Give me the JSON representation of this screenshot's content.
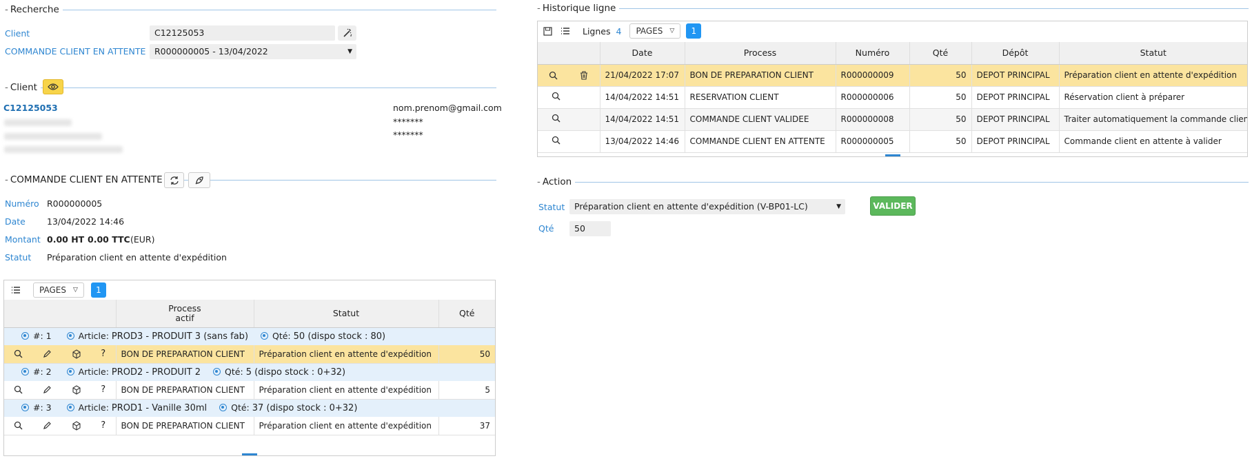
{
  "recherche": {
    "title": "Recherche",
    "client_label": "Client",
    "client_value": "C12125053",
    "commande_label": "COMMANDE CLIENT EN ATTENTE",
    "commande_value": "R000000005 - 13/04/2022"
  },
  "client": {
    "title": "Client",
    "code": "C12125053",
    "email": "nom.prenom@gmail.com",
    "masked1": "*******",
    "masked2": "*******"
  },
  "commande": {
    "title": "COMMANDE CLIENT EN ATTENTE",
    "numero_label": "Numéro",
    "numero": "R000000005",
    "date_label": "Date",
    "date": "13/04/2022 14:46",
    "montant_label": "Montant",
    "montant_ht": "0.00 HT",
    "montant_ttc": "0.00 TTC",
    "devise": "(EUR)",
    "statut_label": "Statut",
    "statut": "Préparation client en attente d'expédition"
  },
  "lines_table": {
    "pages_label": "PAGES",
    "page": "1",
    "headers": {
      "process_1": "Process",
      "process_2": "actif",
      "statut": "Statut",
      "qte": "Qté"
    },
    "groups": [
      {
        "num_label": "#:",
        "num": "1",
        "article_label": "Article:",
        "article": "PROD3 - PRODUIT 3 (sans fab)",
        "qte_label": "Qté:",
        "qte": "50 (dispo stock : 80)",
        "row": {
          "process": "BON DE PREPARATION CLIENT",
          "statut": "Préparation client en attente d'expédition",
          "qte": "50"
        }
      },
      {
        "num_label": "#:",
        "num": "2",
        "article_label": "Article:",
        "article": "PROD2 - PRODUIT 2",
        "qte_label": "Qté:",
        "qte": "5 (dispo stock : 0+32)",
        "row": {
          "process": "BON DE PREPARATION CLIENT",
          "statut": "Préparation client en attente d'expédition",
          "qte": "5"
        }
      },
      {
        "num_label": "#:",
        "num": "3",
        "article_label": "Article:",
        "article": "PROD1 - Vanille 30ml",
        "qte_label": "Qté:",
        "qte": "37 (dispo stock : 0+32)",
        "row": {
          "process": "BON DE PREPARATION CLIENT",
          "statut": "Préparation client en attente d'expédition",
          "qte": "37"
        }
      }
    ]
  },
  "historique": {
    "title": "Historique ligne",
    "lignes_label": "Lignes",
    "lignes_count": "4",
    "pages_label": "PAGES",
    "page": "1",
    "headers": {
      "date": "Date",
      "process": "Process",
      "numero": "Numéro",
      "qte": "Qté",
      "depot": "Dépôt",
      "statut": "Statut"
    },
    "rows": [
      {
        "date": "21/04/2022 17:07",
        "process": "BON DE PREPARATION CLIENT",
        "numero": "R000000009",
        "qte": "50",
        "depot": "DEPOT PRINCIPAL",
        "statut": "Préparation client en attente d'expédition"
      },
      {
        "date": "14/04/2022 14:51",
        "process": "RESERVATION CLIENT",
        "numero": "R000000006",
        "qte": "50",
        "depot": "DEPOT PRINCIPAL",
        "statut": "Réservation client à préparer"
      },
      {
        "date": "14/04/2022 14:51",
        "process": "COMMANDE CLIENT  VALIDEE",
        "numero": "R000000008",
        "qte": "50",
        "depot": "DEPOT PRINCIPAL",
        "statut": "Traiter automatiquement la commande client"
      },
      {
        "date": "13/04/2022 14:46",
        "process": "COMMANDE CLIENT EN ATTENTE",
        "numero": "R000000005",
        "qte": "50",
        "depot": "DEPOT PRINCIPAL",
        "statut": "Commande client en attente à valider"
      }
    ]
  },
  "action": {
    "title": "Action",
    "statut_label": "Statut",
    "statut_value": "Préparation client en attente d'expédition (V-BP01-LC)",
    "qte_label": "Qté",
    "qte_value": "50",
    "valider_label": "VALIDER"
  },
  "colors": {
    "accent": "#2e86d1",
    "highlight": "#fbe49f",
    "valider": "#5cb85c",
    "page_btn": "#2196f3"
  }
}
